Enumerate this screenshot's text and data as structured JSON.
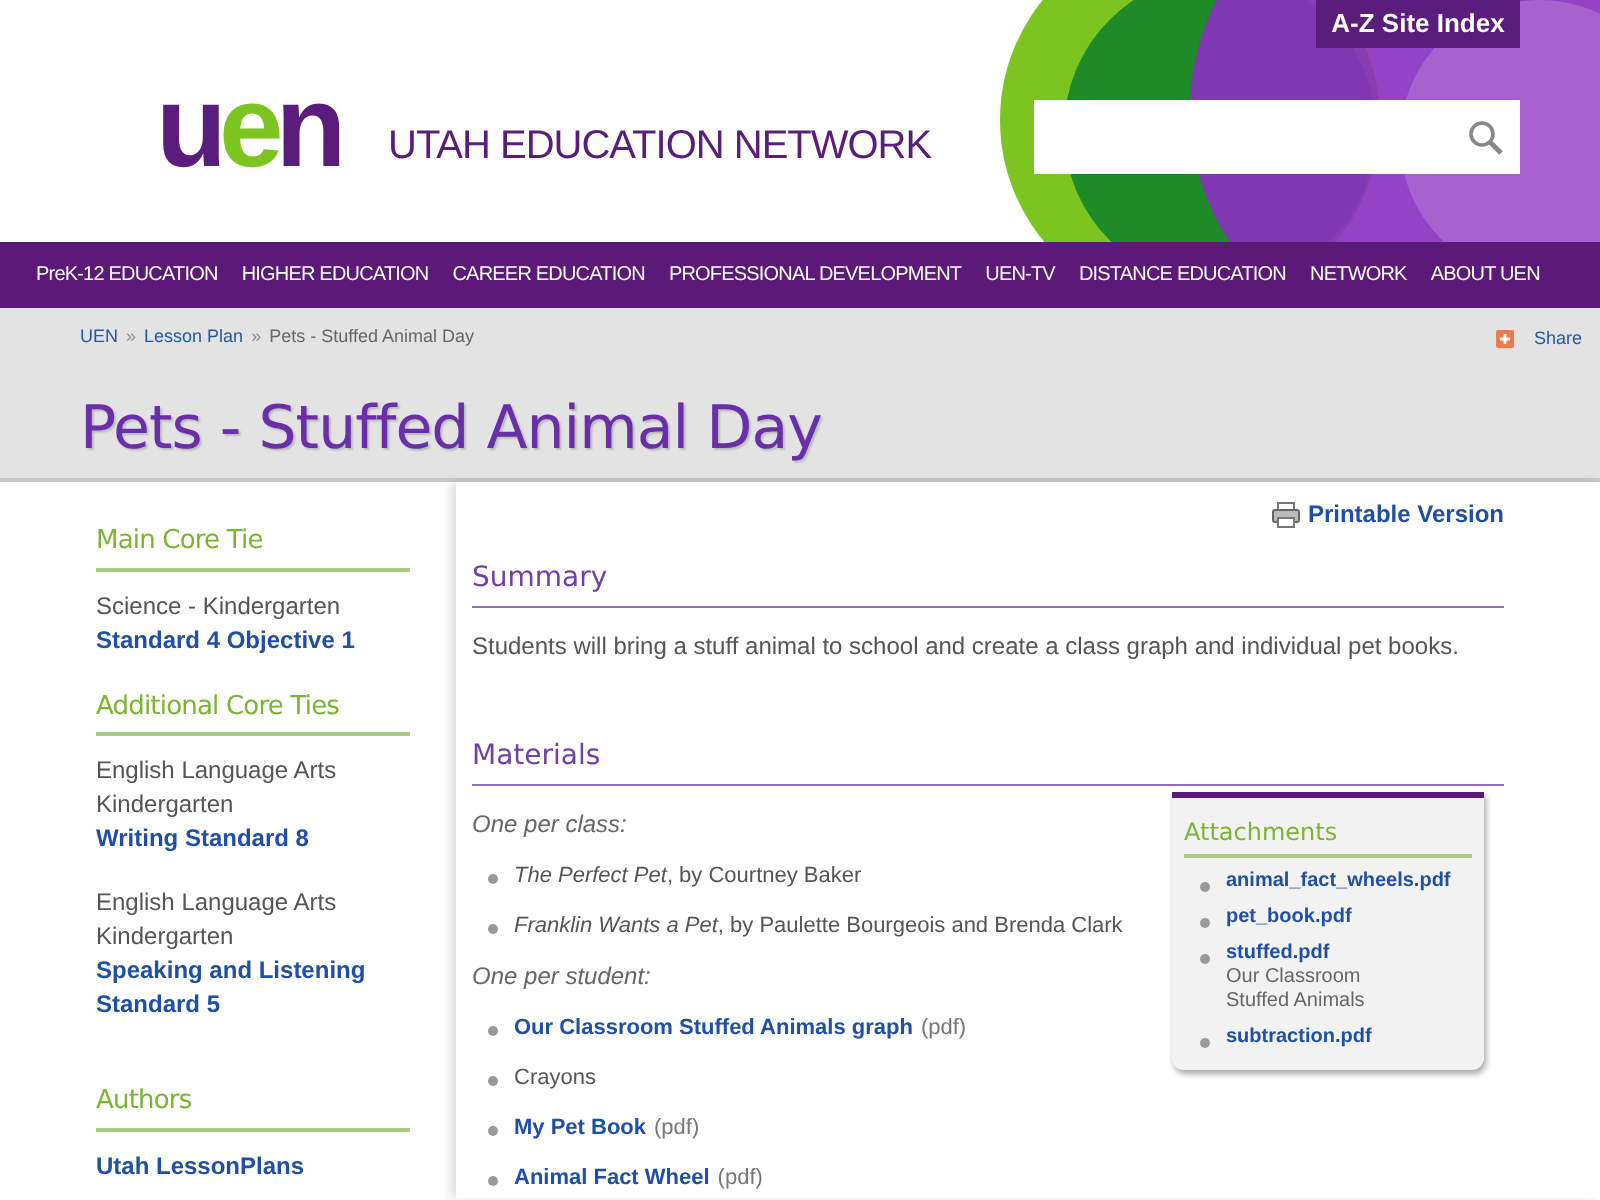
{
  "header": {
    "logo": "uen",
    "site_name": "UTAH EDUCATION NETWORK",
    "site_index": "A-Z Site Index"
  },
  "nav": [
    "PreK-12 EDUCATION",
    "HIGHER EDUCATION",
    "CAREER EDUCATION",
    "PROFESSIONAL DEVELOPMENT",
    "UEN-TV",
    "DISTANCE EDUCATION",
    "NETWORK",
    "ABOUT UEN"
  ],
  "breadcrumb": {
    "links": [
      "UEN",
      "Lesson Plan"
    ],
    "separator": "»",
    "current": "Pets - Stuffed Animal Day"
  },
  "share": "Share",
  "page_title": "Pets - Stuffed Animal Day",
  "sidebar": [
    {
      "heading": "Main Core Tie",
      "groups": [
        {
          "subject": "Science - Kindergarten",
          "link": "Standard 4 Objective 1"
        }
      ]
    },
    {
      "heading": "Additional Core Ties",
      "groups": [
        {
          "subject": "English Language Arts Kindergarten",
          "link": "Writing Standard 8"
        },
        {
          "subject": "English Language Arts Kindergarten",
          "link": "Speaking and Listening Standard 5"
        }
      ]
    },
    {
      "heading": "Authors",
      "groups": [
        {
          "link": "Utah LessonPlans"
        }
      ]
    }
  ],
  "printable": "Printable Version",
  "summary": {
    "heading": "Summary",
    "text": "Students will bring a stuff animal to school and create a class graph and individual pet books."
  },
  "materials": {
    "heading": "Materials",
    "sections": [
      {
        "label": "One per class:",
        "items": [
          {
            "kind": "book",
            "title": "The Perfect Pet",
            "rest": ", by Courtney Baker"
          },
          {
            "kind": "book",
            "title": "Franklin Wants a Pet",
            "rest": ", by Paulette Bourgeois and Brenda Clark"
          }
        ]
      },
      {
        "label": "One per student:",
        "items": [
          {
            "kind": "link",
            "title": "Our Classroom Stuffed Animals graph",
            "rest": "(pdf)"
          },
          {
            "kind": "text",
            "title": "Crayons"
          },
          {
            "kind": "link",
            "title": "My Pet Book",
            "rest": "(pdf)"
          },
          {
            "kind": "link",
            "title": "Animal Fact Wheel",
            "rest": "(pdf)"
          }
        ]
      }
    ]
  },
  "attachments": {
    "heading": "Attachments",
    "items": [
      {
        "file": "animal_fact_wheels.pdf"
      },
      {
        "file": "pet_book.pdf"
      },
      {
        "file": "stuffed.pdf",
        "description": "Our Classroom Stuffed Animals"
      },
      {
        "file": "subtraction.pdf"
      }
    ]
  }
}
